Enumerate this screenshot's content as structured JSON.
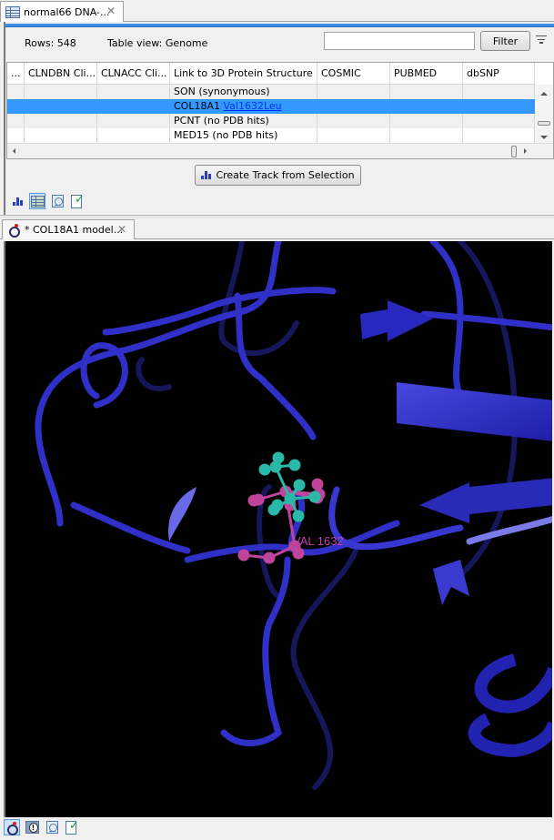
{
  "table_editor": {
    "tab": {
      "icon": "table-icon",
      "title": "normal66 DNA-...",
      "close": "✕"
    },
    "rows_label": "Rows: 548",
    "table_view_label": "Table view: Genome",
    "filter": {
      "value": "",
      "placeholder": "",
      "button_label": "Filter",
      "menu_icon": "filter-options-icon"
    },
    "columns": [
      "...",
      "CLNDBN Cli...",
      "CLNACC Cli...",
      "Link to 3D Protein Structure",
      "COSMIC",
      "PUBMED",
      "dbSNP"
    ],
    "rows": [
      {
        "cells": [
          "",
          "",
          "",
          "SON (synonymous)",
          "",
          "",
          ""
        ],
        "selected": false
      },
      {
        "cells": [
          "",
          "",
          "",
          "COL18A1 ",
          "",
          "",
          ""
        ],
        "link": "Val1632Leu",
        "selected": true
      },
      {
        "cells": [
          "",
          "",
          "",
          "PCNT (no PDB hits)",
          "",
          "",
          ""
        ],
        "selected": false
      },
      {
        "cells": [
          "",
          "",
          "",
          "MED15 (no PDB hits)",
          "",
          "",
          ""
        ],
        "selected": false
      }
    ],
    "create_track_button": "Create Track from Selection",
    "view_icons": [
      "track-view-icon",
      "table-view-icon",
      "history-icon",
      "validation-icon"
    ],
    "active_view": "table-view-icon"
  },
  "structure_editor": {
    "tab": {
      "icon": "molecule-icon",
      "title": "* COL18A1 model...",
      "close": "✕"
    },
    "residue_label": "VAL 1632",
    "colors": {
      "background": "#000000",
      "protein_cartoon": "#2d2dcf",
      "mutant_residue": "#2ab8a8",
      "wildtype_residue": "#c0449c",
      "label": "#c040b0"
    },
    "view_icons": [
      "3d-view-icon",
      "issues-icon",
      "history-icon",
      "validation-icon"
    ],
    "active_view": "3d-view-icon"
  }
}
